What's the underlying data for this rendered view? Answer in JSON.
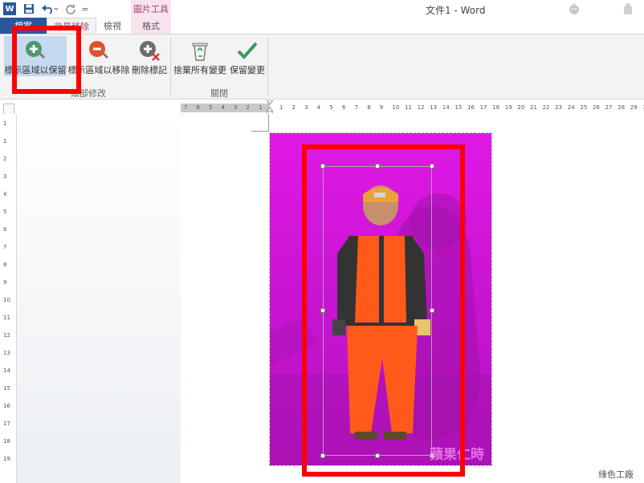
{
  "window": {
    "title": "文件1 - Word"
  },
  "quick_access": {
    "word_logo": "W",
    "more": "="
  },
  "contextual_group": {
    "label": "圖片工具"
  },
  "tabs": [
    {
      "label": "檔案"
    },
    {
      "label": "背景移除"
    },
    {
      "label": "檢視"
    },
    {
      "label": "格式"
    }
  ],
  "ribbon": {
    "buttons": {
      "mark_keep": "標示區域以保留",
      "mark_remove": "標示區域以移除",
      "delete_mark": "刪除標記",
      "discard_all": "捨棄所有變更",
      "keep_changes": "保留變更"
    },
    "groups": {
      "refine": "細部修改",
      "close": "關閉"
    }
  },
  "ruler": {
    "left_ticks": [
      "7",
      "6",
      "5",
      "4",
      "3",
      "2",
      "1"
    ],
    "right_ticks": [
      "1",
      "2",
      "3",
      "4",
      "5",
      "6",
      "7",
      "8",
      "9",
      "10",
      "11",
      "12",
      "13",
      "14",
      "15",
      "16",
      "17",
      "18",
      "19",
      "20",
      "21",
      "22",
      "23",
      "24",
      "25",
      "26",
      "27",
      "28",
      "29",
      "30"
    ],
    "vertical_ticks": [
      "1",
      "1",
      "2",
      "3",
      "4",
      "5",
      "6",
      "7",
      "8",
      "9",
      "10",
      "11",
      "12",
      "13",
      "14",
      "15",
      "16",
      "17",
      "18",
      "19"
    ]
  },
  "watermark": {
    "photo_text": "蘋果仁時",
    "corner_text": "綠色工廠"
  },
  "colors": {
    "ribbon_bg": "#f3f3f3",
    "word_blue": "#2b579a",
    "removed_area": "#e018e5",
    "highlight": "#ff0000",
    "context_tab": "#f9e3ef"
  }
}
